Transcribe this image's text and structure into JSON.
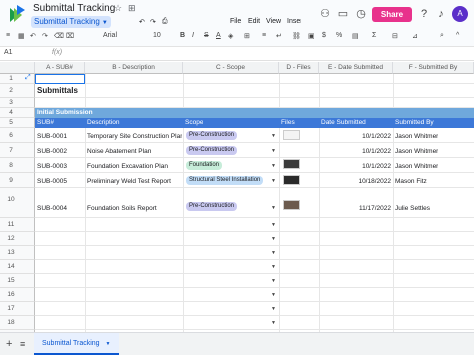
{
  "header": {
    "title": "Submittal Tracking",
    "star_icon": "☆",
    "move_icon": "⊞",
    "sheet_chip_label": "Submittal Tracking",
    "menu": [
      "File",
      "Edit",
      "View",
      "Insert"
    ],
    "share_label": "Share",
    "avatar_initial": "A"
  },
  "toolbar": {
    "font": "Arial",
    "font_size": "10",
    "bold": "B",
    "italic": "I",
    "strike": "S",
    "text_color": "A"
  },
  "formula_bar": {
    "cell_ref": "A1",
    "fx": "f(x)"
  },
  "columns": [
    {
      "label": ""
    },
    {
      "label": "A - SUB#"
    },
    {
      "label": "B - Description"
    },
    {
      "label": "C - Scope"
    },
    {
      "label": "D - Files"
    },
    {
      "label": "E - Date Submitted"
    },
    {
      "label": "F - Submitted By"
    }
  ],
  "section_title": "Submittals",
  "group_label": "Initial Submission",
  "table_headers": [
    "SUB#",
    "Description",
    "Scope",
    "Files",
    "Date Submitted",
    "Submitted By"
  ],
  "rows": [
    {
      "num": "6",
      "sub": "SUB-0001",
      "desc": "Temporary Site Construction Plan",
      "scope": "Pre-Construction",
      "scope_color": "#c9c9f0",
      "date": "10/1/2022",
      "by": "Jason Whitmer"
    },
    {
      "num": "7",
      "sub": "SUB-0002",
      "desc": "Noise Abatement Plan",
      "scope": "Pre-Construction",
      "scope_color": "#c9c9f0",
      "date": "10/1/2022",
      "by": "Jason Whitmer"
    },
    {
      "num": "8",
      "sub": "SUB-0003",
      "desc": "Foundation Excavation Plan",
      "scope": "Foundation",
      "scope_color": "#c6ecd9",
      "date": "10/1/2022",
      "by": "Jason Whitmer"
    },
    {
      "num": "9",
      "sub": "SUB-0005",
      "desc": "Preliminary Weld Test Report",
      "scope": "Structural Steel Installation",
      "scope_color": "#c2ddf7",
      "date": "10/18/2022",
      "by": "Mason Fitz"
    },
    {
      "num": "10",
      "sub": "SUB-0004",
      "desc": "Foundation Soils Report",
      "scope": "Pre-Construction",
      "scope_color": "#c9c9f0",
      "date": "11/17/2022",
      "by": "Julie Settles"
    }
  ],
  "row_numbers": [
    "1",
    "2",
    "3",
    "4",
    "5",
    "6",
    "7",
    "8",
    "9",
    "10",
    "11",
    "12",
    "13",
    "14",
    "15",
    "16",
    "17",
    "18",
    "19"
  ],
  "sheet_tab": "Submittal Tracking",
  "colors": {
    "group_bar": "#6fa8dc",
    "header_bar": "#3c78d8",
    "share": "#e8328c"
  }
}
